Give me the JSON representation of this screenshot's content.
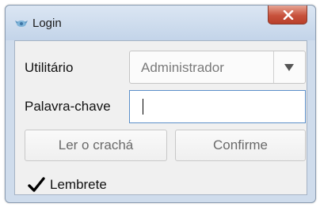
{
  "window": {
    "title": "Login",
    "icon": "app-icon",
    "close_icon": "close-icon"
  },
  "form": {
    "user_label": "Utilitário",
    "user_value": "Administrador",
    "password_label": "Palavra-chave",
    "password_value": ""
  },
  "buttons": {
    "read_badge": "Ler o crachá",
    "confirm": "Confirme"
  },
  "remember": {
    "label": "Lembrete",
    "checked": true
  },
  "colors": {
    "close_button": "#c8523c",
    "input_focus_border": "#5b8fc9"
  }
}
